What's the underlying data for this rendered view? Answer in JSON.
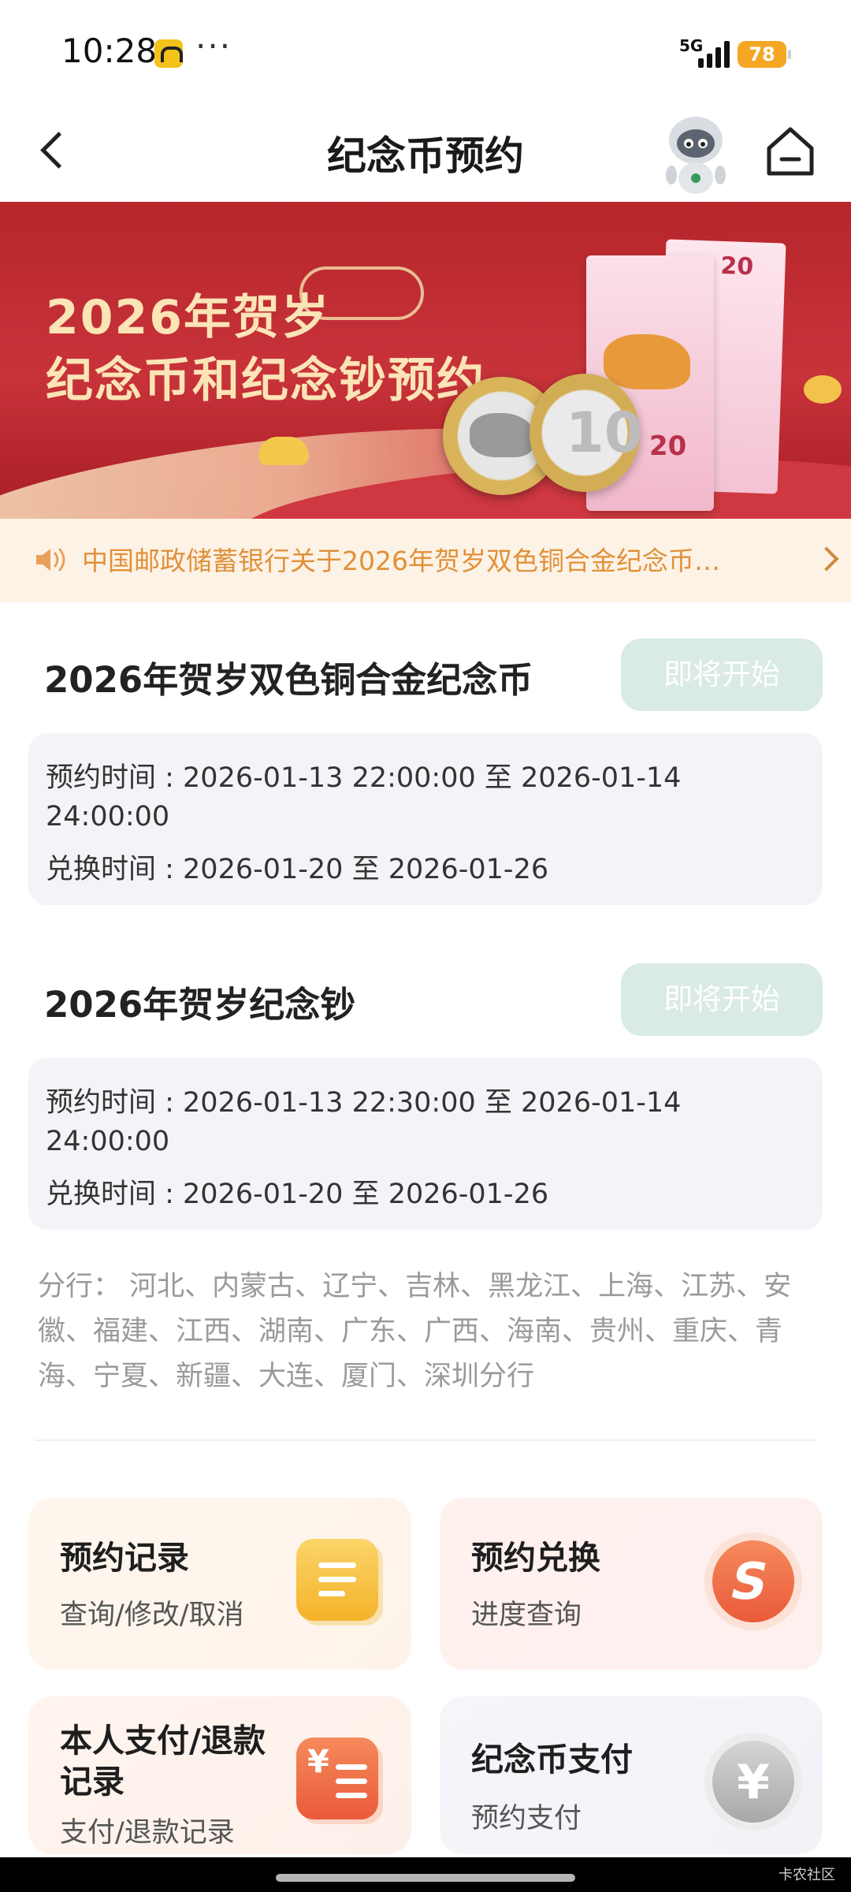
{
  "status_bar": {
    "time": "10:28",
    "dots": "···",
    "network": "5G",
    "battery": "78"
  },
  "nav": {
    "title": "纪念币预约"
  },
  "banner": {
    "line1": "2026年贺岁",
    "line2": "纪念币和纪念钞预约",
    "note_value": "20",
    "note_value2": "20",
    "coin_value": "10"
  },
  "notice": {
    "text": "中国邮政储蓄银行关于2026年贺岁双色铜合金纪念币…"
  },
  "sections": [
    {
      "title": "2026年贺岁双色铜合金纪念币",
      "button": "即将开始",
      "lines": [
        "预约时间 : 2026-01-13 22:00:00 至 2026-01-14",
        "24:00:00",
        "兑换时间 : 2026-01-20 至 2026-01-26"
      ]
    },
    {
      "title": "2026年贺岁纪念钞",
      "button": "即将开始",
      "lines": [
        "预约时间 : 2026-01-13 22:30:00 至 2026-01-14",
        "24:00:00",
        "兑换时间 : 2026-01-20 至 2026-01-26"
      ]
    }
  ],
  "branches": "分行： 河北、内蒙古、辽宁、吉林、黑龙江、上海、江苏、安徽、福建、江西、湖南、广东、广西、海南、贵州、重庆、青海、宁夏、新疆、大连、厦门、深圳分行",
  "cards": [
    {
      "title": "预约记录",
      "sub": "查询/修改/取消",
      "icon": "list-icon"
    },
    {
      "title": "预约兑换",
      "sub": "进度查询",
      "icon": "exchange-icon"
    },
    {
      "title": "本人支付/退款记录",
      "sub": "支付/退款记录",
      "icon": "payment-record-icon"
    },
    {
      "title": "纪念币支付",
      "sub": "预约支付",
      "icon": "yen-coin-icon"
    }
  ],
  "icons": {
    "yen": "¥",
    "pay_yen": "¥",
    "swap": "S"
  },
  "watermark": "卡农社区",
  "colors": {
    "notice_text": "#e0913a",
    "soon_button": "#d9ebe3",
    "banner_red": "#c8333a"
  }
}
